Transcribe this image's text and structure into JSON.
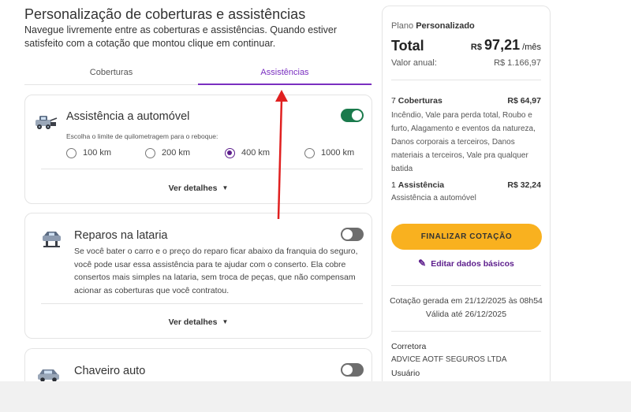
{
  "header": {
    "title": "Personalização de coberturas e assistências",
    "intro": "Navegue livremente entre as coberturas e assistências. Quando estiver satisfeito com a cotação que montou clique em continuar."
  },
  "tabs": [
    {
      "label": "Coberturas",
      "active": false
    },
    {
      "label": "Assistências",
      "active": true
    }
  ],
  "cards": {
    "auto_assist": {
      "title": "Assistência a automóvel",
      "enabled": true,
      "sub_label": "Escolha o limite de quilometragem para o reboque:",
      "options": [
        "100 km",
        "200 km",
        "400 km",
        "1000 km"
      ],
      "selected": "400 km",
      "details_label": "Ver detalhes"
    },
    "body_repair": {
      "title": "Reparos na lataria",
      "enabled": false,
      "description": "Se você bater o carro e o preço do reparo ficar abaixo da franquia do seguro, você pode usar essa assistência para te ajudar com o conserto. Ela cobre consertos mais simples na lataria, sem troca de peças, que não compensam acionar as coberturas que você contratou.",
      "details_label": "Ver detalhes"
    },
    "locksmith": {
      "title": "Chaveiro auto",
      "enabled": false
    }
  },
  "summary": {
    "plan_prefix": "Plano",
    "plan_name": "Personalizado",
    "total_label": "Total",
    "currency": "R$",
    "total_value": "97,21",
    "per_month": "/mês",
    "annual_label": "Valor anual:",
    "annual_value": "R$ 1.166,97",
    "coverages_count": "7",
    "coverages_label": "Coberturas",
    "coverages_price": "R$ 64,97",
    "coverages_list": "Incêndio, Vale para perda total, Roubo e furto, Alagamento e eventos da natureza, Danos corporais a terceiros, Danos materiais a terceiros, Vale pra qualquer batida",
    "assist_count": "1",
    "assist_label": "Assistência",
    "assist_price": "R$ 32,24",
    "assist_list": "Assistência a automóvel",
    "finalize_label": "FINALIZAR COTAÇÃO",
    "edit_label": "Editar dados básicos",
    "generated": "Cotação gerada em 21/12/2025 às 08h54",
    "valid_until": "Válida até 26/12/2025",
    "broker_label": "Corretora",
    "broker_name": "ADVICE AOTF SEGUROS LTDA",
    "user_label": "Usuário"
  },
  "colors": {
    "accent": "#7a2fc0",
    "toggle_on": "#1a7a4c",
    "cta": "#f9b11f",
    "arrow": "#e02020"
  },
  "icons": {
    "auto": "tow-truck-icon",
    "repair": "car-lift-icon",
    "locksmith": "car-key-icon",
    "details": "chevron-down-icon",
    "edit": "pencil-icon"
  }
}
